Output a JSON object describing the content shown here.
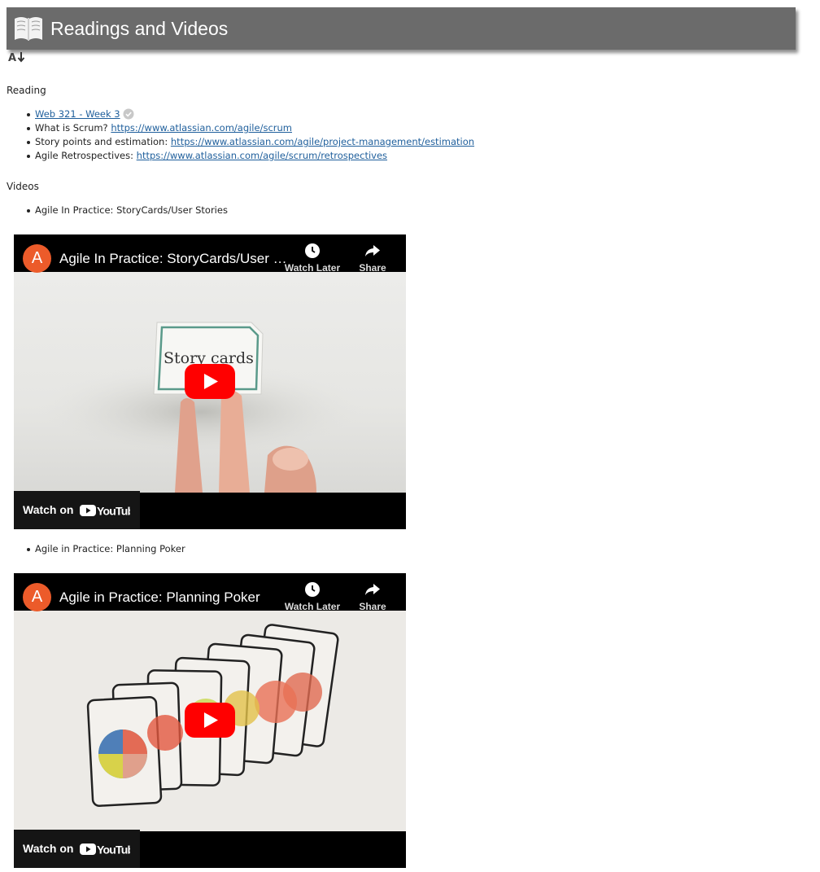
{
  "banner": {
    "title": "Readings and Videos",
    "icon": "open-book-icon",
    "color": "#6b6b6b"
  },
  "sort_icon": "sort-az-down-icon",
  "reading": {
    "heading": "Reading",
    "items": [
      {
        "link": "Web 321 - Week 3",
        "status_icon": "check-circle-icon"
      },
      {
        "label": "What is Scrum? ",
        "link": "https://www.atlassian.com/agile/scrum"
      },
      {
        "label": "Story points and estimation: ",
        "link": "https://www.atlassian.com/agile/project-management/estimation"
      },
      {
        "label": "Agile Retrospectives: ",
        "link": "https://www.atlassian.com/agile/scrum/retrospectives"
      }
    ]
  },
  "videos": {
    "heading": "Videos",
    "items": [
      {
        "label": "Agile In Practice: StoryCards/User Stories",
        "player": {
          "channel_initial": "A",
          "title": "Agile In Practice: StoryCards/User S...",
          "watch_later": "Watch Later",
          "share": "Share",
          "thumbnail_text": "Story cards",
          "watch_on": "Watch on",
          "youtube": "YouTube"
        }
      },
      {
        "label": "Agile in Practice: Planning Poker",
        "player": {
          "channel_initial": "A",
          "title": "Agile in Practice: Planning Poker",
          "watch_later": "Watch Later",
          "share": "Share",
          "watch_on": "Watch on",
          "youtube": "YouTube"
        }
      }
    ]
  },
  "colors": {
    "link": "#1f5f9c",
    "avatar": "#ec5b2a",
    "play": "#ff0000"
  }
}
